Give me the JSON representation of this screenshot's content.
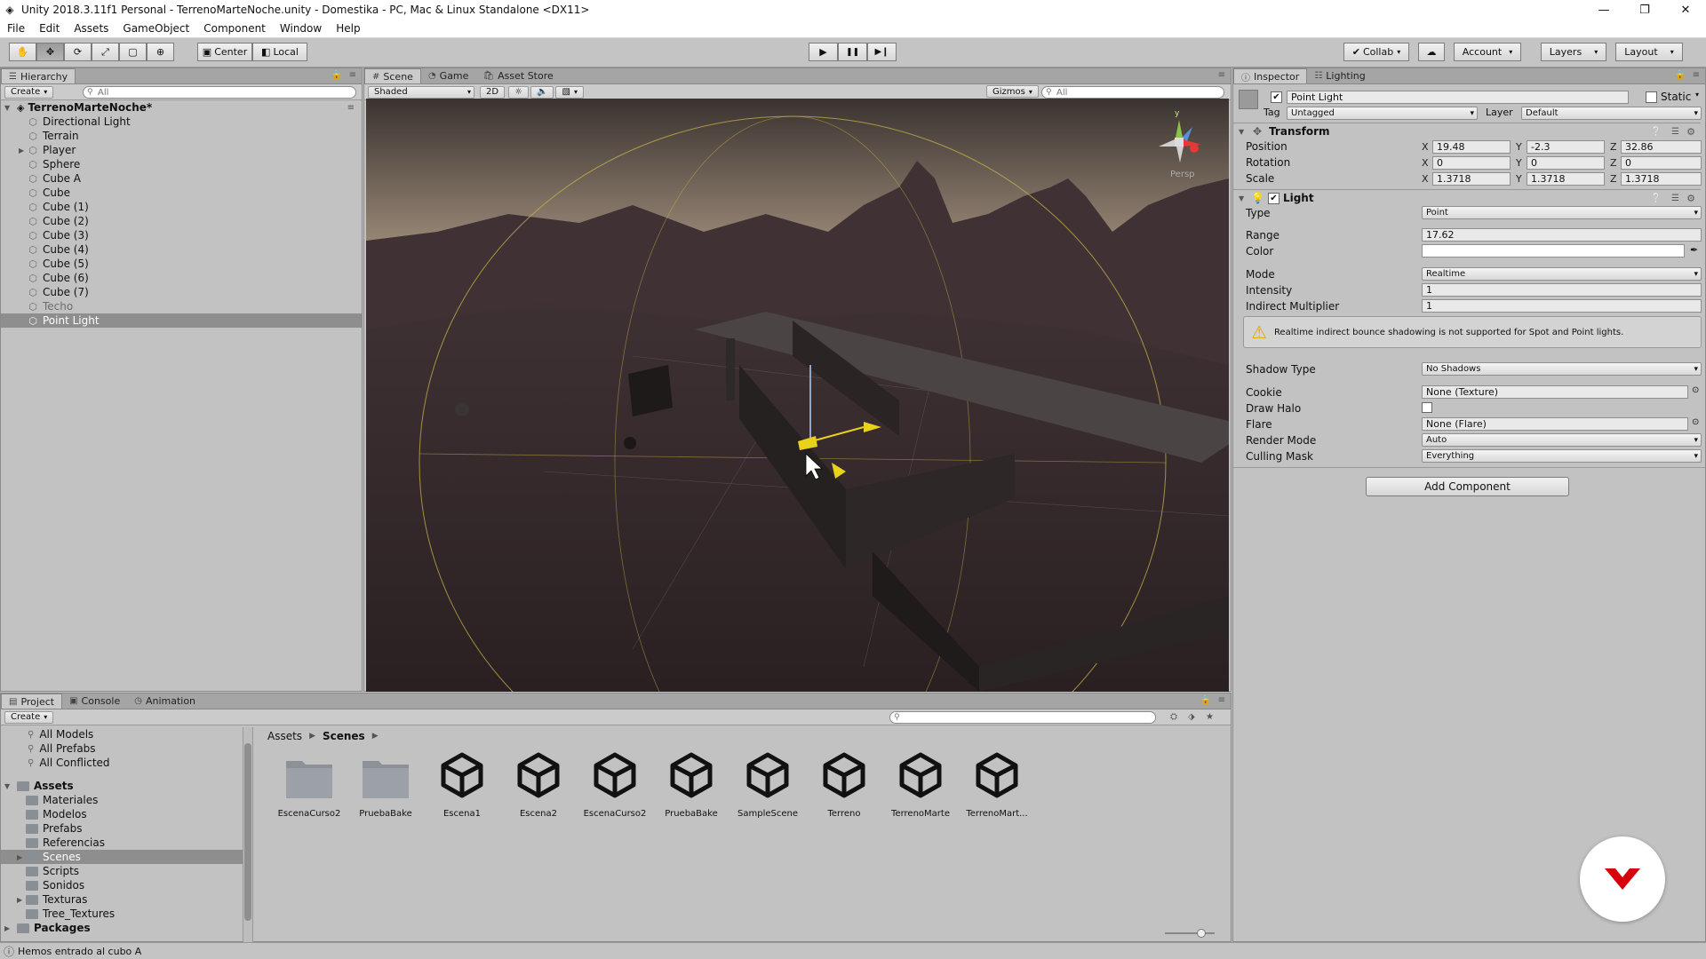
{
  "window": {
    "title": "Unity 2018.3.11f1 Personal - TerrenoMarteNoche.unity - Domestika - PC, Mac & Linux Standalone <DX11>",
    "minimize": "—",
    "restore": "❐",
    "close": "✕"
  },
  "menu": [
    "File",
    "Edit",
    "Assets",
    "GameObject",
    "Component",
    "Window",
    "Help"
  ],
  "toolbar": {
    "tools": [
      "hand-tool",
      "move-tool",
      "rotate-tool",
      "scale-tool",
      "rect-tool",
      "transform-tool"
    ],
    "tool_glyphs": [
      "✋",
      "✥",
      "⟳",
      "⤢",
      "▢",
      "⊕"
    ],
    "pivot": "Center",
    "space": "Local",
    "play": "▶",
    "pause": "❚❚",
    "step": "▶❙",
    "collab": "Collab",
    "account": "Account",
    "layers": "Layers",
    "layout": "Layout"
  },
  "hierarchy": {
    "tab": "Hierarchy",
    "create": "Create",
    "search_placeholder": "All",
    "scene": "TerrenoMarteNoche*",
    "items": [
      {
        "label": "Directional Light",
        "arrow": false
      },
      {
        "label": "Terrain",
        "arrow": false
      },
      {
        "label": "Player",
        "arrow": true
      },
      {
        "label": "Sphere",
        "arrow": false
      },
      {
        "label": "Cube A",
        "arrow": false
      },
      {
        "label": "Cube",
        "arrow": false
      },
      {
        "label": "Cube (1)",
        "arrow": false
      },
      {
        "label": "Cube (2)",
        "arrow": false
      },
      {
        "label": "Cube (3)",
        "arrow": false
      },
      {
        "label": "Cube (4)",
        "arrow": false
      },
      {
        "label": "Cube (5)",
        "arrow": false
      },
      {
        "label": "Cube (6)",
        "arrow": false
      },
      {
        "label": "Cube (7)",
        "arrow": false
      },
      {
        "label": "Techo",
        "arrow": false,
        "gray": true
      },
      {
        "label": "Point Light",
        "arrow": false,
        "selected": true
      }
    ]
  },
  "scene": {
    "tabs": [
      "Scene",
      "Game",
      "Asset Store"
    ],
    "shading": "Shaded",
    "mode_2d": "2D",
    "gizmos": "Gizmos",
    "search_placeholder": "All",
    "persp": "Persp",
    "gizmo_axes": {
      "x": "x",
      "y": "y",
      "z": "z"
    }
  },
  "inspector": {
    "tabs": [
      "Inspector",
      "Lighting"
    ],
    "object_name": "Point Light",
    "static_label": "Static",
    "tag_label": "Tag",
    "tag_value": "Untagged",
    "layer_label": "Layer",
    "layer_value": "Default",
    "transform": {
      "header": "Transform",
      "position_label": "Position",
      "rotation_label": "Rotation",
      "scale_label": "Scale",
      "axis_x": "X",
      "axis_y": "Y",
      "axis_z": "Z",
      "position": [
        "19.48",
        "-2.3",
        "32.86"
      ],
      "rotation": [
        "0",
        "0",
        "0"
      ],
      "scale": [
        "1.3718",
        "1.3718",
        "1.3718"
      ]
    },
    "light": {
      "header": "Light",
      "type_label": "Type",
      "type_value": "Point",
      "range_label": "Range",
      "range_value": "17.62",
      "color_label": "Color",
      "mode_label": "Mode",
      "mode_value": "Realtime",
      "intensity_label": "Intensity",
      "intensity_value": "1",
      "indirect_label": "Indirect Multiplier",
      "indirect_value": "1",
      "warning": "Realtime indirect bounce shadowing is not supported for Spot and Point lights.",
      "shadow_label": "Shadow Type",
      "shadow_value": "No Shadows",
      "cookie_label": "Cookie",
      "cookie_value": "None (Texture)",
      "halo_label": "Draw Halo",
      "flare_label": "Flare",
      "flare_value": "None (Flare)",
      "render_label": "Render Mode",
      "render_value": "Auto",
      "culling_label": "Culling Mask",
      "culling_value": "Everything"
    },
    "add_component": "Add Component"
  },
  "project": {
    "tabs": [
      "Project",
      "Console",
      "Animation"
    ],
    "create": "Create",
    "favorites": [
      "All Models",
      "All Prefabs",
      "All Conflicted"
    ],
    "assets_root": "Assets",
    "folders": [
      {
        "label": "Materiales",
        "arrow": false
      },
      {
        "label": "Modelos",
        "arrow": false
      },
      {
        "label": "Prefabs",
        "arrow": false
      },
      {
        "label": "Referencias",
        "arrow": false
      },
      {
        "label": "Scenes",
        "arrow": true,
        "selected": true
      },
      {
        "label": "Scripts",
        "arrow": false
      },
      {
        "label": "Sonidos",
        "arrow": false
      },
      {
        "label": "Texturas",
        "arrow": true
      },
      {
        "label": "Tree_Textures",
        "arrow": false
      }
    ],
    "packages": "Packages",
    "breadcrumb": [
      "Assets",
      "Scenes"
    ],
    "assets": [
      {
        "label": "EscenaCurso2",
        "kind": "folder"
      },
      {
        "label": "PruebaBake",
        "kind": "folder"
      },
      {
        "label": "Escena1",
        "kind": "scene"
      },
      {
        "label": "Escena2",
        "kind": "scene"
      },
      {
        "label": "EscenaCurso2",
        "kind": "scene"
      },
      {
        "label": "PruebaBake",
        "kind": "scene"
      },
      {
        "label": "SampleScene",
        "kind": "scene"
      },
      {
        "label": "Terreno",
        "kind": "scene"
      },
      {
        "label": "TerrenoMarte",
        "kind": "scene"
      },
      {
        "label": "TerrenoMart...",
        "kind": "scene"
      }
    ]
  },
  "status": "Hemos entrado al cubo A"
}
